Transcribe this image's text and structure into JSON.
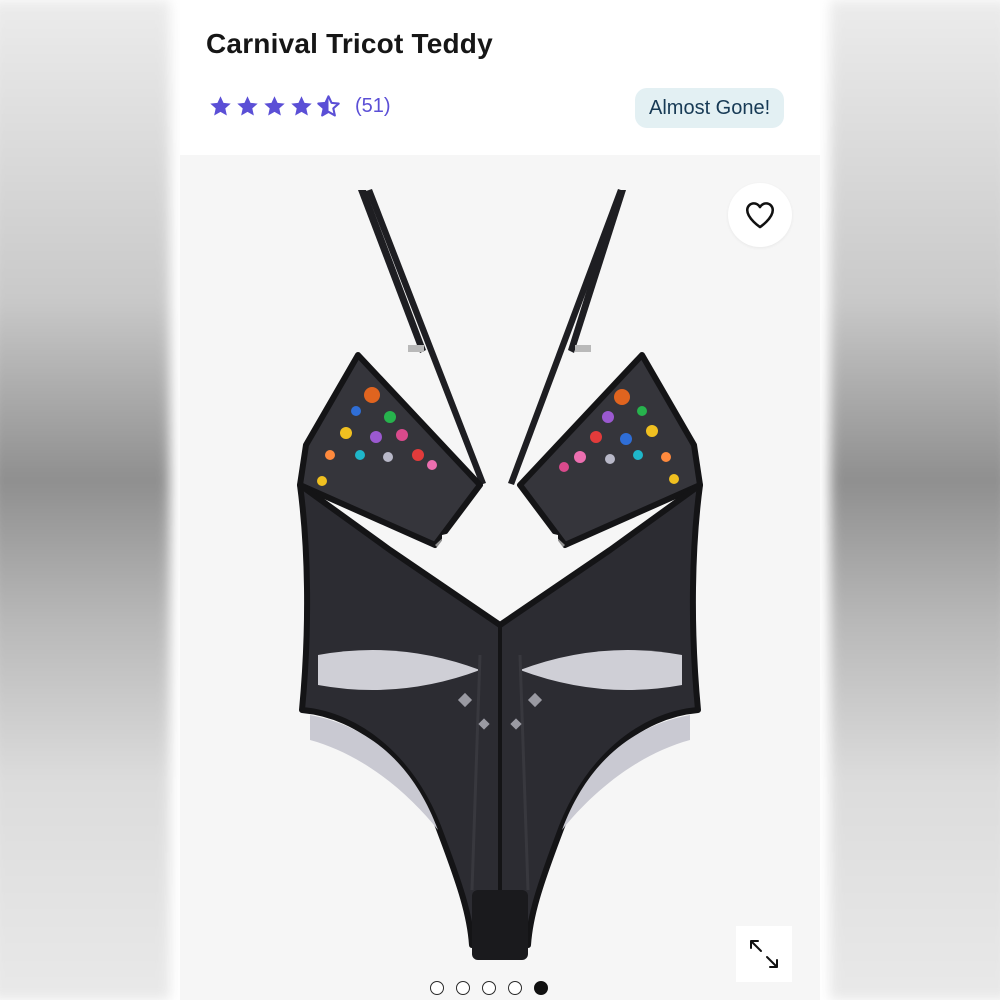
{
  "product": {
    "title": "Carnival Tricot Teddy",
    "rating": {
      "stars": 4.5,
      "max_stars": 5,
      "count_label": "(51)",
      "star_color": "#5b4fd6"
    },
    "badge": "Almost Gone!"
  },
  "gallery": {
    "image_alt": "Black mesh teddy with colorful jewel embellishments",
    "total_images": 5,
    "active_index": 4,
    "favorite_icon": "heart-outline-icon",
    "expand_icon": "expand-arrows-icon"
  },
  "colors": {
    "accent": "#5b4fd6",
    "badge_bg": "#e3f0f3",
    "badge_text": "#173a55",
    "garment": "#1e1e22"
  }
}
